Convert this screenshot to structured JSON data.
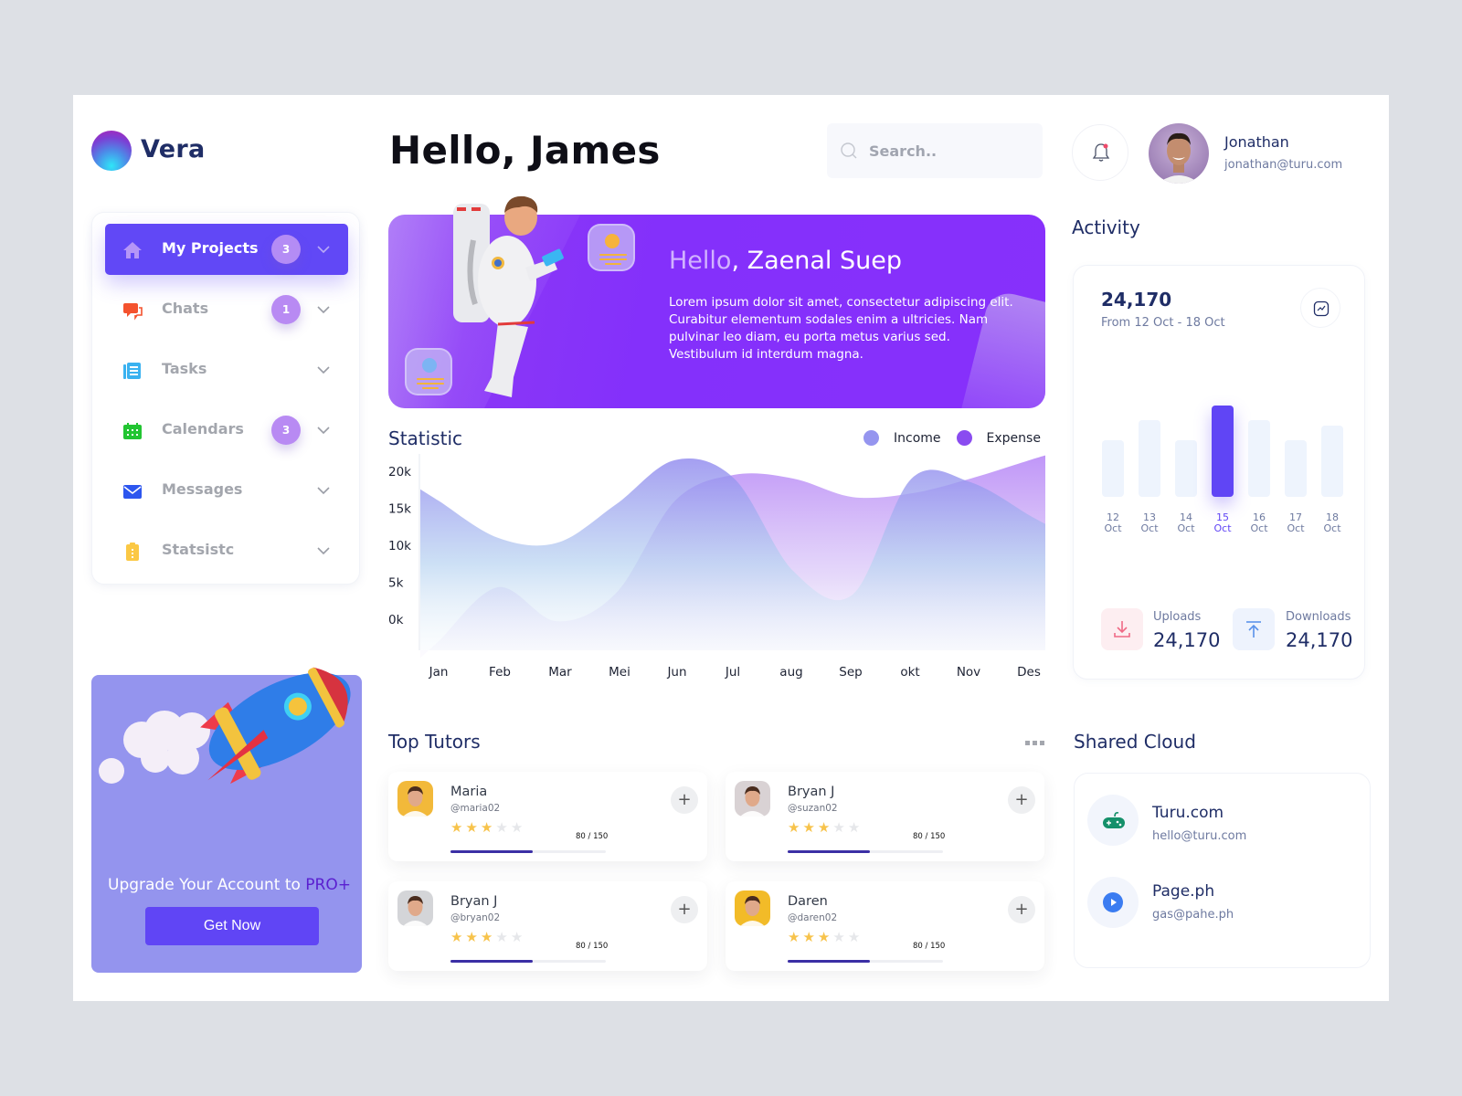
{
  "brand": {
    "name": "Vera"
  },
  "header": {
    "greeting": "Hello, James",
    "search_placeholder": "Search..",
    "search_value": "",
    "notification_dot": true,
    "user": {
      "name": "Jonathan",
      "email": "jonathan@turu.com"
    }
  },
  "sidebar": {
    "items": [
      {
        "label": "My Projects",
        "icon": "home-icon",
        "badge": "3",
        "active": true
      },
      {
        "label": "Chats",
        "icon": "chat-icon",
        "badge": "1",
        "active": false
      },
      {
        "label": "Tasks",
        "icon": "document-icon",
        "badge": null,
        "active": false
      },
      {
        "label": "Calendars",
        "icon": "calendar-icon",
        "badge": "3",
        "active": false
      },
      {
        "label": "Messages",
        "icon": "mail-icon",
        "badge": null,
        "active": false
      },
      {
        "label": "Statsistc",
        "icon": "clipboard-icon",
        "badge": null,
        "active": false
      }
    ],
    "upgrade": {
      "text_prefix": "Upgrade Your Account to ",
      "text_highlight": "PRO+",
      "button_label": "Get Now"
    }
  },
  "banner": {
    "title_faint": "Hello",
    "title_main": ", Zaenal Suep",
    "body": "Lorem ipsum dolor sit amet, consectetur adipiscing elit. Curabitur elementum sodales enim a ultricies. Nam pulvinar leo diam, eu porta metus varius sed. Vestibulum id interdum magna."
  },
  "statistic": {
    "title": "Statistic",
    "legend": [
      {
        "label": "Income",
        "color": "#9595ef"
      },
      {
        "label": "Expense",
        "color": "#8a4cf0"
      }
    ]
  },
  "chart_data": {
    "type": "area",
    "title": "Statistic",
    "xlabel": "",
    "ylabel": "",
    "categories": [
      "Jan",
      "Feb",
      "Mar",
      "Mei",
      "Jun",
      "Jul",
      "aug",
      "Sep",
      "okt",
      "Nov",
      "Des"
    ],
    "y_ticks": [
      "0k",
      "5k",
      "10k",
      "15k",
      "20k"
    ],
    "ylim": [
      0,
      20000
    ],
    "grid": false,
    "legend_position": "top-right",
    "series": [
      {
        "name": "Income",
        "color": "#9595ef",
        "values": [
          17500,
          12500,
          11800,
          17000,
          23000,
          20500,
          8000,
          4800,
          20500,
          20000,
          15500
        ]
      },
      {
        "name": "Expense",
        "color": "#a970f3",
        "values": [
          -1500,
          5800,
          1200,
          5000,
          17500,
          21000,
          20500,
          18000,
          18500,
          20500,
          23000
        ]
      }
    ]
  },
  "activity": {
    "title": "Activity",
    "total": "24,170",
    "range": "From 12 Oct - 18 Oct",
    "bars": [
      {
        "day": "12",
        "month": "Oct",
        "value": 0.62,
        "highlight": false
      },
      {
        "day": "13",
        "month": "Oct",
        "value": 0.84,
        "highlight": false
      },
      {
        "day": "14",
        "month": "Oct",
        "value": 0.62,
        "highlight": false
      },
      {
        "day": "15",
        "month": "Oct",
        "value": 1.0,
        "highlight": true
      },
      {
        "day": "16",
        "month": "Oct",
        "value": 0.84,
        "highlight": false
      },
      {
        "day": "17",
        "month": "Oct",
        "value": 0.62,
        "highlight": false
      },
      {
        "day": "18",
        "month": "Oct",
        "value": 0.78,
        "highlight": false
      }
    ],
    "uploads": {
      "label": "Uploads",
      "value": "24,170"
    },
    "downloads": {
      "label": "Downloads",
      "value": "24,170"
    }
  },
  "top_tutors": {
    "title": "Top Tutors",
    "tutors": [
      {
        "name": "Maria",
        "handle": "@maria02",
        "stars": 3,
        "max_stars": 5,
        "score": "80 / 150",
        "progress": 0.53,
        "avatar_bg": "#f2b93a"
      },
      {
        "name": "Bryan J",
        "handle": "@suzan02",
        "stars": 3,
        "max_stars": 5,
        "score": "80 / 150",
        "progress": 0.53,
        "avatar_bg": "#d9d2d4"
      },
      {
        "name": "Bryan J",
        "handle": "@bryan02",
        "stars": 3,
        "max_stars": 5,
        "score": "80 / 150",
        "progress": 0.53,
        "avatar_bg": "#d4d5d8"
      },
      {
        "name": "Daren",
        "handle": "@daren02",
        "stars": 3,
        "max_stars": 5,
        "score": "80 / 150",
        "progress": 0.53,
        "avatar_bg": "#f2bb28"
      }
    ]
  },
  "shared_cloud": {
    "title": "Shared Cloud",
    "items": [
      {
        "name": "Turu.com",
        "email": "hello@turu.com",
        "icon": "gamepad-icon"
      },
      {
        "name": "Page.ph",
        "email": "gas@pahe.ph",
        "icon": "play-icon"
      }
    ]
  }
}
